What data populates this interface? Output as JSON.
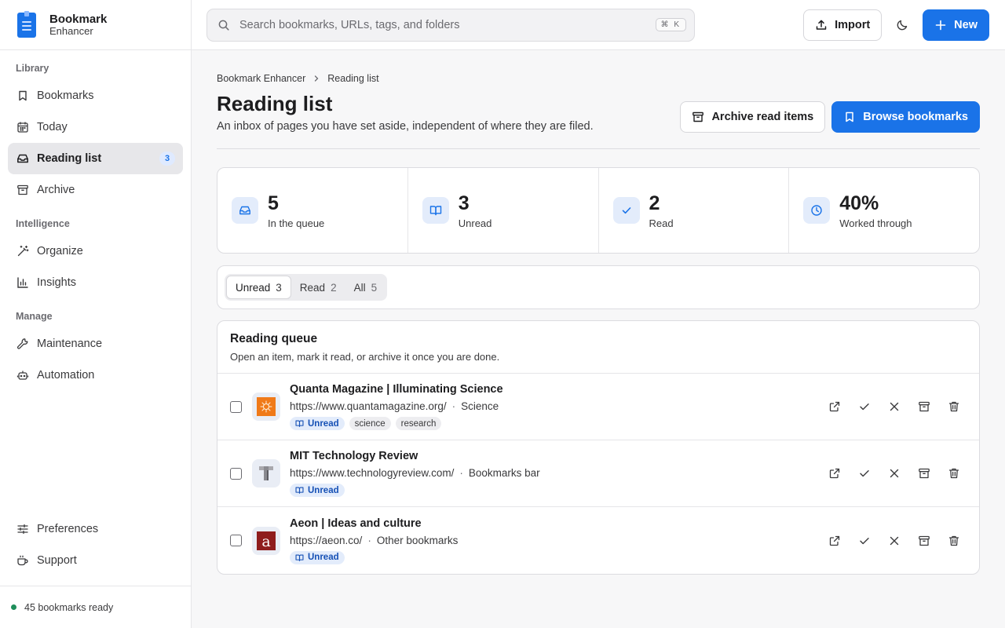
{
  "brand": {
    "title": "Bookmark",
    "subtitle": "Enhancer"
  },
  "sidebar": {
    "sections": [
      {
        "label": "Library"
      },
      {
        "label": "Intelligence"
      },
      {
        "label": "Manage"
      }
    ],
    "library": [
      {
        "label": "Bookmarks",
        "icon": "bookmark-icon"
      },
      {
        "label": "Today",
        "icon": "calendar-icon"
      },
      {
        "label": "Reading list",
        "icon": "inbox-icon",
        "badge": "3",
        "active": true
      },
      {
        "label": "Archive",
        "icon": "archive-icon"
      }
    ],
    "intelligence": [
      {
        "label": "Organize",
        "icon": "magic-wand-icon"
      },
      {
        "label": "Insights",
        "icon": "bar-chart-icon"
      }
    ],
    "manage": [
      {
        "label": "Maintenance",
        "icon": "wrench-icon"
      },
      {
        "label": "Automation",
        "icon": "bot-icon"
      }
    ],
    "bottom": [
      {
        "label": "Preferences",
        "icon": "sliders-icon"
      },
      {
        "label": "Support",
        "icon": "coffee-cup-icon"
      }
    ],
    "footer": {
      "status": "45 bookmarks ready",
      "status_color": "#1e8e5a"
    }
  },
  "topbar": {
    "search_placeholder": "Search bookmarks, URLs, tags, and folders",
    "shortcut": "⌘ K",
    "import_label": "Import",
    "new_label": "New"
  },
  "breadcrumb": [
    "Bookmark Enhancer",
    "Reading list"
  ],
  "page": {
    "title": "Reading list",
    "description": "An inbox of pages you have set aside, independent of where they are filed.",
    "archive_button": "Archive read items",
    "browse_button": "Browse bookmarks"
  },
  "stats": [
    {
      "value": "5",
      "label": "In the queue",
      "icon": "inbox-icon"
    },
    {
      "value": "3",
      "label": "Unread",
      "icon": "open-book-icon"
    },
    {
      "value": "2",
      "label": "Read",
      "icon": "check-icon"
    },
    {
      "value": "40%",
      "label": "Worked through",
      "icon": "clock-icon"
    }
  ],
  "filters": [
    {
      "label": "Unread",
      "count": "3",
      "active": true
    },
    {
      "label": "Read",
      "count": "2"
    },
    {
      "label": "All",
      "count": "5"
    }
  ],
  "queue": {
    "title": "Reading queue",
    "description": "Open an item, mark it read, or archive it once you are done.",
    "items": [
      {
        "title": "Quanta Magazine | Illuminating Science",
        "url": "https://www.quantamagazine.org/",
        "folder": "Science",
        "status": "Unread",
        "tags": [
          "science",
          "research"
        ],
        "favicon": "quanta-logo"
      },
      {
        "title": "MIT Technology Review",
        "url": "https://www.technologyreview.com/",
        "folder": "Bookmarks bar",
        "status": "Unread",
        "tags": [],
        "favicon": "mit-tr-logo"
      },
      {
        "title": "Aeon | Ideas and culture",
        "url": "https://aeon.co/",
        "folder": "Other bookmarks",
        "status": "Unread",
        "tags": [],
        "favicon": "aeon-logo"
      }
    ]
  },
  "colors": {
    "accent": "#1a73e8",
    "unread_chip_bg": "#e3ecfb",
    "unread_chip_text": "#1550b5"
  }
}
